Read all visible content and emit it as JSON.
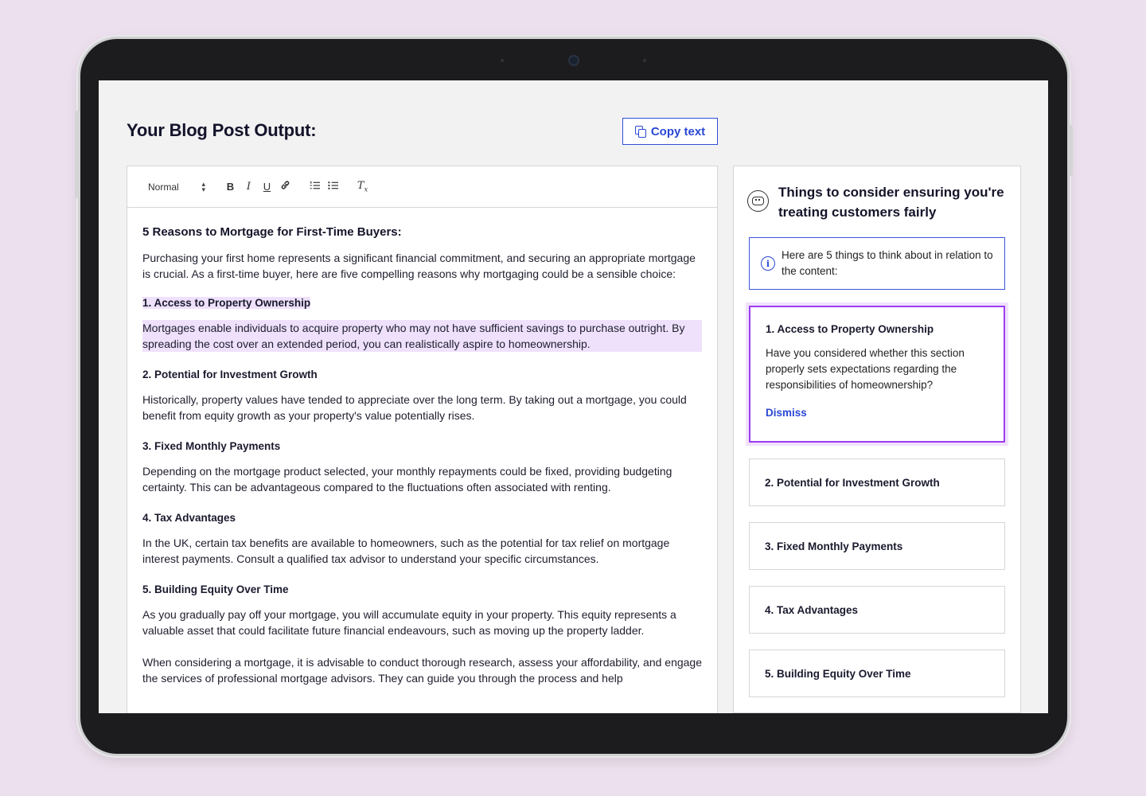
{
  "header": {
    "title": "Your Blog Post Output:",
    "copy_label": "Copy text"
  },
  "toolbar": {
    "format_select": "Normal",
    "bold": "B",
    "italic": "I",
    "underline": "U",
    "link_icon": "link-icon",
    "ordered_list_icon": "ordered-list-icon",
    "bullet_list_icon": "bullet-list-icon",
    "clear_format_icon": "clear-format-icon"
  },
  "document": {
    "title": "5 Reasons to Mortgage for First-Time Buyers:",
    "intro": "Purchasing your first home represents a significant financial commitment, and securing an appropriate mortgage is crucial. As a first-time buyer, here are five compelling reasons why mortgaging could be a sensible choice:",
    "sections": [
      {
        "heading": "1. Access to Property Ownership",
        "body": "Mortgages enable individuals to acquire property who may not have sufficient savings to purchase outright. By spreading the cost over an extended period, you can realistically aspire to homeownership."
      },
      {
        "heading": "2. Potential for Investment Growth",
        "body": "Historically, property values have tended to appreciate over the long term. By taking out a mortgage, you could benefit from equity growth as your property's value potentially rises."
      },
      {
        "heading": "3. Fixed Monthly Payments",
        "body": "Depending on the mortgage product selected, your monthly repayments could be fixed, providing budgeting certainty. This can be advantageous compared to the fluctuations often associated with renting."
      },
      {
        "heading": "4. Tax Advantages",
        "body": "In the UK, certain tax benefits are available to homeowners, such as the potential for tax relief on mortgage interest payments. Consult a qualified tax advisor to understand your specific circumstances."
      },
      {
        "heading": "5. Building Equity Over Time",
        "body": "As you gradually pay off your mortgage, you will accumulate equity in your property. This equity represents a valuable asset that could facilitate future financial endeavours, such as moving up the property ladder."
      }
    ],
    "closing": "When considering a mortgage, it is advisable to conduct thorough research, assess your affordability, and engage the services of professional mortgage advisors. They can guide you through the process and help"
  },
  "panel": {
    "icon": "robot-icon",
    "title": "Things to consider ensuring you're treating customers fairly",
    "info": "Here are 5 things to think about in relation to the content:",
    "active_card": {
      "title": "1. Access to Property Ownership",
      "body": "Have you considered whether this section properly sets expectations regarding the responsibilities of homeownership?",
      "dismiss": "Dismiss"
    },
    "cards": [
      "2. Potential for Investment Growth",
      "3. Fixed Monthly Payments",
      "4. Tax Advantages",
      "5. Building Equity Over Time"
    ]
  },
  "colors": {
    "accent": "#2a48d4",
    "highlight": "#efe1fb",
    "active_border": "#9d3cf0",
    "background": "#ede0ee"
  }
}
